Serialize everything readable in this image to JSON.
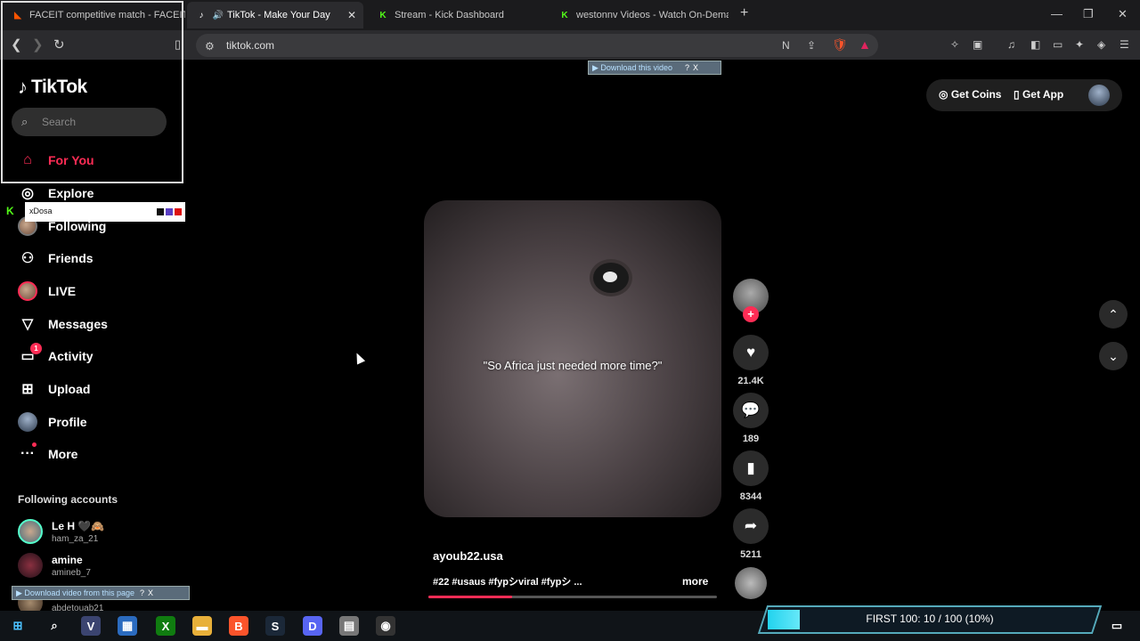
{
  "browser": {
    "tabs": [
      {
        "title": "FACEIT competitive match - FACEIT.c",
        "favicon": "faceit-icon"
      },
      {
        "title": "TikTok - Make Your Day",
        "favicon": "tiktok-icon",
        "active": true
      },
      {
        "title": "Stream - Kick Dashboard",
        "favicon": "kick-icon"
      },
      {
        "title": "westonnv Videos - Watch On-Deman",
        "favicon": "kick-icon"
      }
    ],
    "new_tab": "+",
    "url": "tiktok.com"
  },
  "download_bar_top": {
    "label": "▶ Download this video",
    "q": "?",
    "x": "X"
  },
  "download_bar_bottom": {
    "label": "▶ Download video from this page",
    "q": "?",
    "x": "X"
  },
  "sidebar": {
    "logo": "TikTok",
    "search_placeholder": "Search",
    "nav": [
      {
        "label": "For You",
        "icon": "home-icon"
      },
      {
        "label": "Explore",
        "icon": "compass-icon"
      },
      {
        "label": "Following",
        "icon": "following-avatar-icon"
      },
      {
        "label": "Friends",
        "icon": "friends-icon"
      },
      {
        "label": "LIVE",
        "icon": "live-icon"
      },
      {
        "label": "Messages",
        "icon": "paper-plane-icon"
      },
      {
        "label": "Activity",
        "icon": "activity-icon",
        "badge": "1"
      },
      {
        "label": "Upload",
        "icon": "plus-square-icon"
      },
      {
        "label": "Profile",
        "icon": "profile-icon"
      },
      {
        "label": "More",
        "icon": "ellipsis-icon"
      }
    ],
    "kick_overlay_name": "xDosa",
    "following_title": "Following accounts",
    "accounts": [
      {
        "name": "Le H 🖤🙈",
        "handle": "ham_za_21"
      },
      {
        "name": "amine",
        "handle": "amineb_7"
      },
      {
        "name": "",
        "handle": "abdetouab21"
      }
    ]
  },
  "top_right": {
    "coins": "Get Coins",
    "app": "Get App"
  },
  "video": {
    "caption": "\"So Africa just needed more time?\"",
    "author": "ayoub22.usa",
    "description": "#22 #usaus #fypシviral #fypシ ...",
    "more": "more",
    "progress": 0.29
  },
  "actions": {
    "likes": "21.4K",
    "comments": "189",
    "saves": "8344",
    "shares": "5211"
  },
  "stream_goal": {
    "text": "FIRST 100:  10 / 100 (10%)",
    "progress": 0.1
  },
  "colors": {
    "accent": "#fe2c55",
    "kick_green": "#53fc18"
  }
}
